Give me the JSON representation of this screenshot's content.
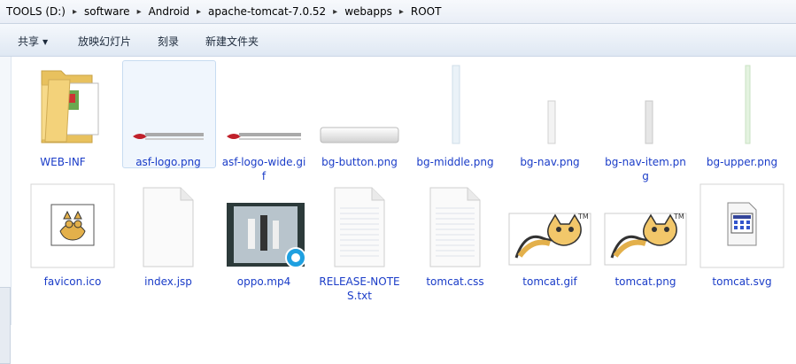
{
  "address": {
    "crumbs": [
      "TOOLS (D:)",
      "software",
      "Android",
      "apache-tomcat-7.0.52",
      "webapps",
      "ROOT"
    ]
  },
  "toolbar": {
    "share_label": "共享",
    "slideshow_label": "放映幻灯片",
    "burn_label": "刻录",
    "new_folder_label": "新建文件夹"
  },
  "files": [
    {
      "name": "WEB-INF",
      "icon": "folder-icon"
    },
    {
      "name": "asf-logo.png",
      "icon": "image-thumbnail-icon",
      "selected": true
    },
    {
      "name": "asf-logo-wide.gif",
      "icon": "image-thumbnail-icon"
    },
    {
      "name": "bg-button.png",
      "icon": "image-thumbnail-icon"
    },
    {
      "name": "bg-middle.png",
      "icon": "image-thumbnail-icon"
    },
    {
      "name": "bg-nav.png",
      "icon": "image-thumbnail-icon"
    },
    {
      "name": "bg-nav-item.png",
      "icon": "image-thumbnail-icon"
    },
    {
      "name": "bg-upper.png",
      "icon": "image-thumbnail-icon"
    },
    {
      "name": "favicon.ico",
      "icon": "tomcat-icon"
    },
    {
      "name": "index.jsp",
      "icon": "blank-document-icon"
    },
    {
      "name": "oppo.mp4",
      "icon": "video-thumbnail-icon"
    },
    {
      "name": "RELEASE-NOTES.txt",
      "icon": "text-document-icon"
    },
    {
      "name": "tomcat.css",
      "icon": "text-document-icon"
    },
    {
      "name": "tomcat.gif",
      "icon": "tomcat-image-icon"
    },
    {
      "name": "tomcat.png",
      "icon": "tomcat-image-icon"
    },
    {
      "name": "tomcat.svg",
      "icon": "svg-document-icon"
    }
  ],
  "colors": {
    "label": "#1a3cc8",
    "selection": "#f0f6fd",
    "folder": "#f3d27a"
  }
}
